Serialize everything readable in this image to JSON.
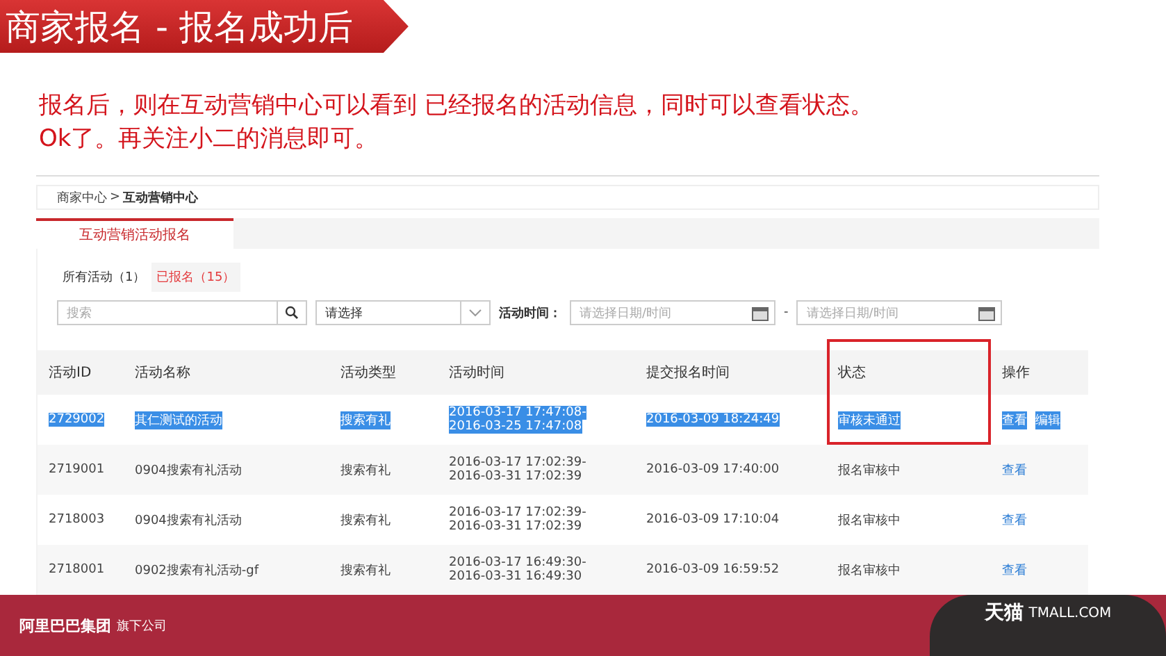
{
  "slide_title": "商家报名 - 报名成功后",
  "intro": [
    "报名后，则在互动营销中心可以看到 已经报名的活动信息，同时可以查看状态。",
    "Ok了。再关注小二的消息即可。"
  ],
  "breadcrumb": {
    "parent": "商家中心",
    "separator": ">",
    "current": "互动营销中心"
  },
  "tabs": [
    {
      "label": "互动营销活动报名",
      "selected": true
    }
  ],
  "filters": [
    {
      "label": "所有活动（1）",
      "selected": false
    },
    {
      "label": "已报名（15）",
      "selected": true
    }
  ],
  "search": {
    "placeholder": "搜索"
  },
  "type_select": {
    "value": "请选择"
  },
  "time_filter": {
    "label": "活动时间：",
    "start_placeholder": "请选择日期/时间",
    "separator": "-",
    "end_placeholder": "请选择日期/时间"
  },
  "table": {
    "columns": [
      {
        "label": "活动ID",
        "highlighted": false
      },
      {
        "label": "活动名称",
        "highlighted": false
      },
      {
        "label": "活动类型",
        "highlighted": false
      },
      {
        "label": "活动时间",
        "highlighted": false
      },
      {
        "label": "提交报名时间",
        "highlighted": false
      },
      {
        "label": "状态",
        "highlighted": true
      },
      {
        "label": "操作",
        "highlighted": false
      }
    ],
    "rows": [
      {
        "selected": true,
        "id": "2729002",
        "name": "其仁测试的活动",
        "type": "搜索有礼",
        "time": [
          "2016-03-17 17:47:08-",
          "2016-03-25 17:47:08"
        ],
        "submitted": "2016-03-09 18:24:49",
        "status": "审核未通过",
        "actions": [
          "查看",
          "编辑"
        ]
      },
      {
        "selected": false,
        "id": "2719001",
        "name": "0904搜索有礼活动",
        "type": "搜索有礼",
        "time": [
          "2016-03-17 17:02:39-",
          "2016-03-31 17:02:39"
        ],
        "submitted": "2016-03-09 17:40:00",
        "status": "报名审核中",
        "actions": [
          "查看"
        ]
      },
      {
        "selected": false,
        "id": "2718003",
        "name": "0904搜索有礼活动",
        "type": "搜索有礼",
        "time": [
          "2016-03-17 17:02:39-",
          "2016-03-31 17:02:39"
        ],
        "submitted": "2016-03-09 17:10:04",
        "status": "报名审核中",
        "actions": [
          "查看"
        ]
      },
      {
        "selected": false,
        "id": "2718001",
        "name": "0902搜索有礼活动-gf",
        "type": "搜索有礼",
        "time": [
          "2016-03-17 16:49:30-",
          "2016-03-31 16:49:30"
        ],
        "submitted": "2016-03-09 16:59:52",
        "status": "报名审核中",
        "actions": [
          "查看"
        ]
      }
    ]
  },
  "footer": {
    "company": "阿里巴巴集团",
    "suffix": "旗下公司",
    "brand": "天猫",
    "brand_domain": "TMALL.COM"
  }
}
